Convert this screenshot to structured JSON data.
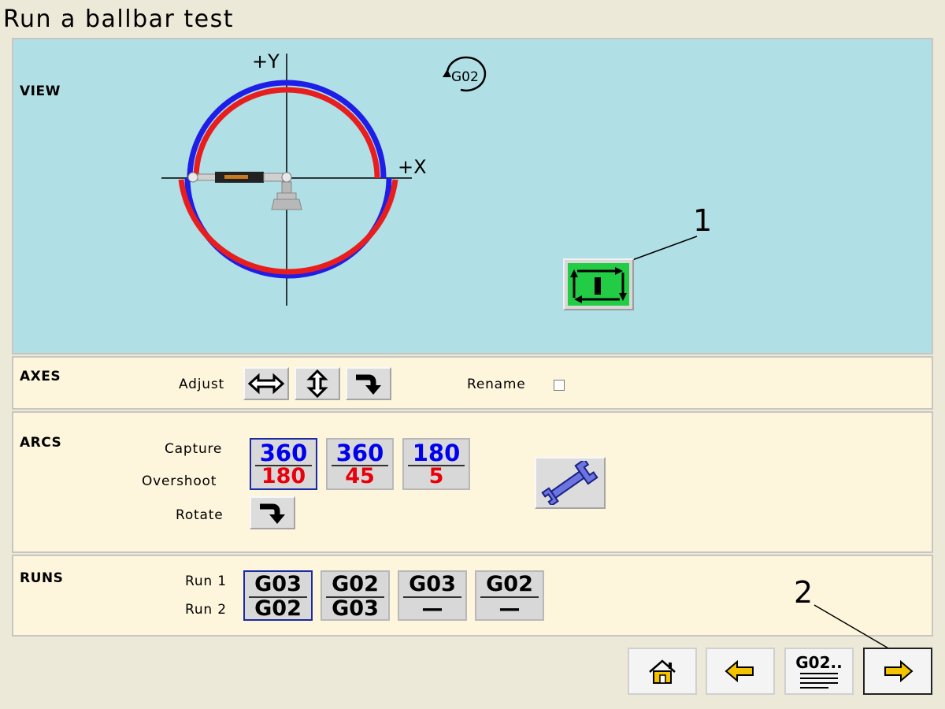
{
  "title": "Run a ballbar test",
  "view": {
    "label": "VIEW",
    "axis_y": "+Y",
    "axis_x": "+X",
    "direction_badge": "G02",
    "colors": {
      "outer_arc": "#1e1ee8",
      "inner_arc": "#e81e1e",
      "background": "#b0dfe5",
      "start_button": "#22cc44"
    }
  },
  "axes": {
    "label": "AXES",
    "adjust_label": "Adjust",
    "rename_label": "Rename",
    "rename_checked": false,
    "icons": [
      "swap-horizontal-icon",
      "swap-vertical-icon",
      "rotate-arrow-icon"
    ]
  },
  "arcs": {
    "label": "ARCS",
    "capture_label": "Capture",
    "overshoot_label": "Overshoot",
    "rotate_label": "Rotate",
    "options": [
      {
        "capture": "360",
        "overshoot": "180",
        "selected": true
      },
      {
        "capture": "360",
        "overshoot": "45",
        "selected": false
      },
      {
        "capture": "180",
        "overshoot": "5",
        "selected": false
      }
    ]
  },
  "runs": {
    "label": "RUNS",
    "run1_label": "Run 1",
    "run2_label": "Run 2",
    "options": [
      {
        "run1": "G03",
        "run2": "G02",
        "selected": true
      },
      {
        "run1": "G02",
        "run2": "G03",
        "selected": false
      },
      {
        "run1": "G03",
        "run2": "—",
        "selected": false
      },
      {
        "run1": "G02",
        "run2": "—",
        "selected": false
      }
    ]
  },
  "nav": {
    "program_label": "G02..",
    "icons": [
      "home-icon",
      "back-arrow-icon",
      "program-list-icon",
      "next-arrow-icon"
    ]
  },
  "callouts": {
    "one": "1",
    "two": "2"
  }
}
